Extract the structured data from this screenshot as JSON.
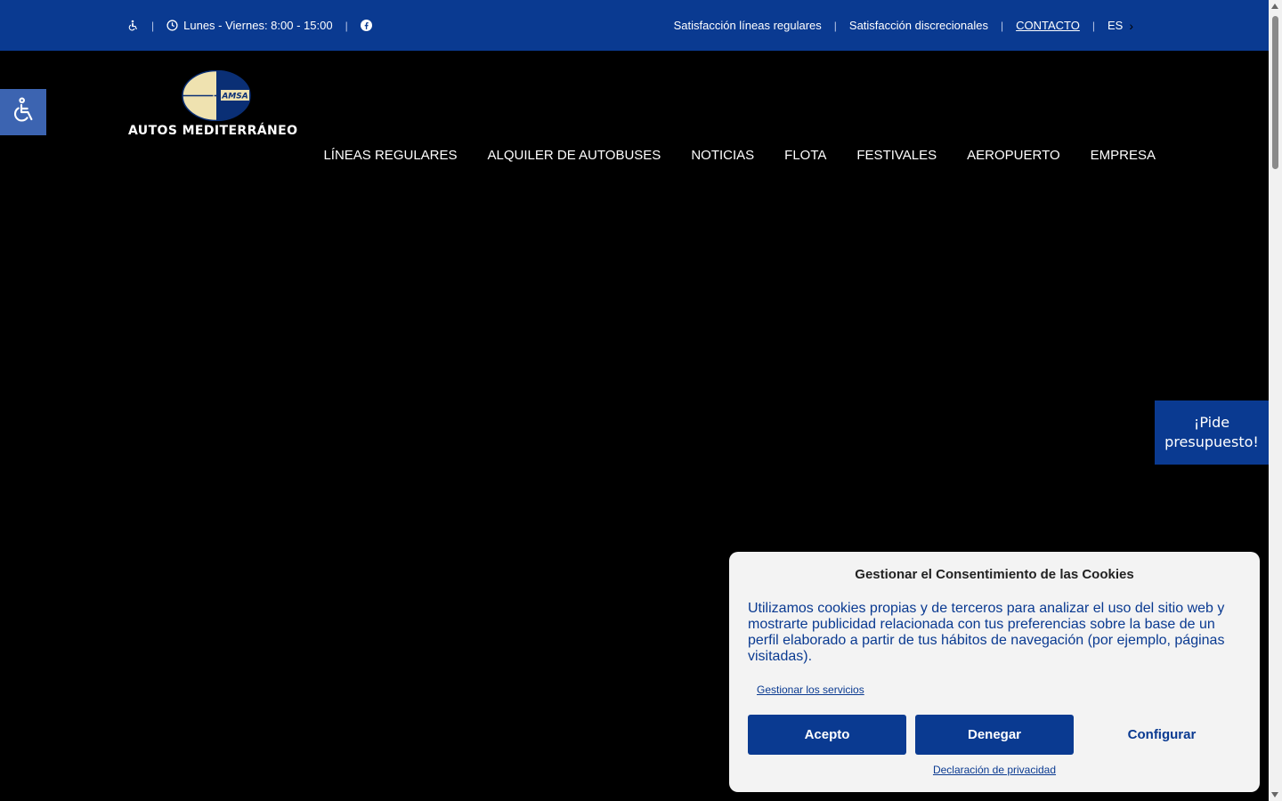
{
  "topbar": {
    "hours": "Lunes - Viernes: 8:00 - 15:00",
    "links": {
      "satisfaccion_regulares": "Satisfacción líneas regulares",
      "satisfaccion_discrecionales": "Satisfacción discrecionales",
      "contacto": "CONTACTO"
    },
    "language": "ES",
    "icons": [
      "wheelchair-icon",
      "clock-icon",
      "facebook-icon",
      "chevron-right-icon"
    ]
  },
  "logo": {
    "emblem_text": "AMSA",
    "name": "AUTOS MEDITERRÁNEO"
  },
  "nav": {
    "items": [
      "LÍNEAS REGULARES",
      "ALQUILER DE AUTOBUSES",
      "NOTICIAS",
      "FLOTA",
      "FESTIVALES",
      "AEROPUERTO",
      "EMPRESA"
    ]
  },
  "quote_tab": {
    "line1": "¡Pide",
    "line2": "presupuesto!"
  },
  "cookie": {
    "title": "Gestionar el Consentimiento de las Cookies",
    "body": "Utilizamos cookies propias y de terceros para analizar el uso del sitio web y mostrarte publicidad relacionada con tus preferencias sobre la base de un perfil elaborado a partir de tus hábitos de navegación (por ejemplo, páginas visitadas).",
    "manage_link": "Gestionar los servicios",
    "accept": "Acepto",
    "deny": "Denegar",
    "configure": "Configurar",
    "privacy_link": "Declaración de privacidad"
  },
  "colors": {
    "brand_blue": "#0a3a91",
    "accessibility_blue": "#3c64b1",
    "logo_cream": "#efe2b0"
  }
}
